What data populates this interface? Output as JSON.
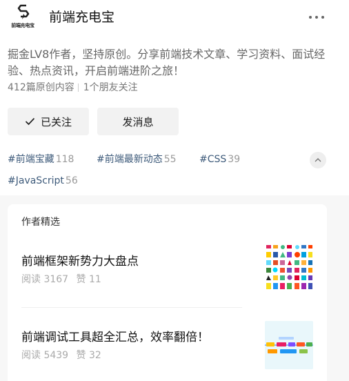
{
  "account": {
    "logo_text": "前端充电宝",
    "name": "前端充电宝"
  },
  "intro": "掘金LV8作者，坚持原创。分享前端技术文章、学习资料、面试经验、热点资讯，开启前端进阶之旅！",
  "stats": {
    "articles": "412篇原创内容",
    "followers": "1个朋友关注"
  },
  "buttons": {
    "follow": "已关注",
    "message": "发消息"
  },
  "tags": [
    {
      "name": "#前端宝藏",
      "count": "118"
    },
    {
      "name": "#前端最新动态",
      "count": "55"
    },
    {
      "name": "#CSS",
      "count": "39"
    },
    {
      "name": "#JavaScript",
      "count": "56"
    }
  ],
  "featured": {
    "title": "作者精选",
    "articles": [
      {
        "title": "前端框架新势力大盘点",
        "reads": "阅读 3167",
        "likes": "赞 11"
      },
      {
        "title": "前端调试工具超全汇总，效率翻倍！",
        "reads": "阅读 5439",
        "likes": "赞 32"
      }
    ]
  },
  "colors": {
    "tag_name": "#3d5a7a",
    "muted": "#999999",
    "button_bg": "#f2f2f2",
    "section_bg": "#f7f7f7"
  }
}
